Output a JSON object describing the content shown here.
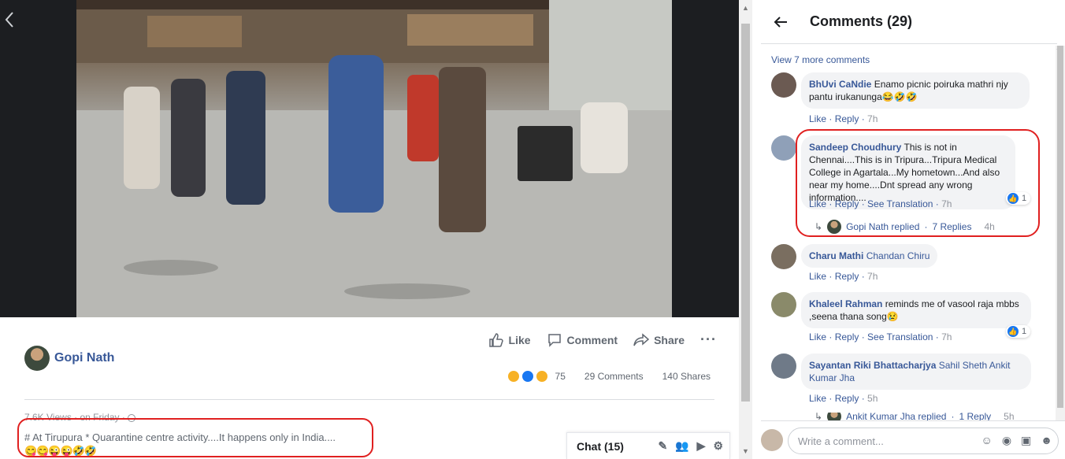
{
  "post": {
    "author": "Gopi Nath",
    "actions": {
      "like": "Like",
      "comment": "Comment",
      "share": "Share",
      "more": "···"
    },
    "reaction_count": "75",
    "comments_count": "29 Comments",
    "shares_count": "140 Shares",
    "meta": "7.6K Views · on Friday ·",
    "caption": "# At Tirupura * Quarantine centre activity....It happens only in India....",
    "caption_emojis": "😋😋😜😜🤣🤣"
  },
  "chat": {
    "label": "Chat (15)"
  },
  "panel": {
    "title": "Comments (29)",
    "view_more": "View 7 more comments",
    "comments": [
      {
        "name": "BhUvi CaNdie",
        "text": "Enamo picnic poiruka mathri njy pantu irukanunga😂🤣🤣",
        "like": "Like",
        "reply": "Reply",
        "time": "7h",
        "avatar_color": "#6b5a52"
      },
      {
        "name": "Sandeep Choudhury",
        "text": "This is not in Chennai....This is in Tripura...Tripura Medical College in Agartala...My hometown...And also near my home....Dnt spread any wrong information....",
        "like": "Like",
        "reply": "Reply",
        "translate": "See Translation",
        "time": "7h",
        "reaction_count": "1",
        "avatar_color": "#8fa0b8",
        "reply_summary": {
          "who": "Gopi Nath replied",
          "count": "7 Replies",
          "time": "4h"
        }
      },
      {
        "name": "Charu Mathi",
        "tag": "Chandan Chiru",
        "like": "Like",
        "reply": "Reply",
        "time": "7h",
        "avatar_color": "#7a6e60"
      },
      {
        "name": "Khaleel Rahman",
        "text": "reminds me of vasool raja mbbs ,seena thana song😢",
        "like": "Like",
        "reply": "Reply",
        "translate": "See Translation",
        "time": "7h",
        "reaction_count": "1",
        "avatar_color": "#8a8a6a"
      },
      {
        "name": "Sayantan Riki Bhattacharjya",
        "tag": "Sahil Sheth Ankit Kumar Jha",
        "like": "Like",
        "reply": "Reply",
        "time": "5h",
        "avatar_color": "#6f7a88",
        "reply_summary": {
          "who": "Ankit Kumar Jha replied",
          "count": "1 Reply",
          "time": "5h"
        }
      }
    ]
  },
  "composer": {
    "placeholder": "Write a comment..."
  },
  "colors": {
    "link": "#385898",
    "highlight": "#e02020",
    "bubble": "#f2f3f5"
  }
}
